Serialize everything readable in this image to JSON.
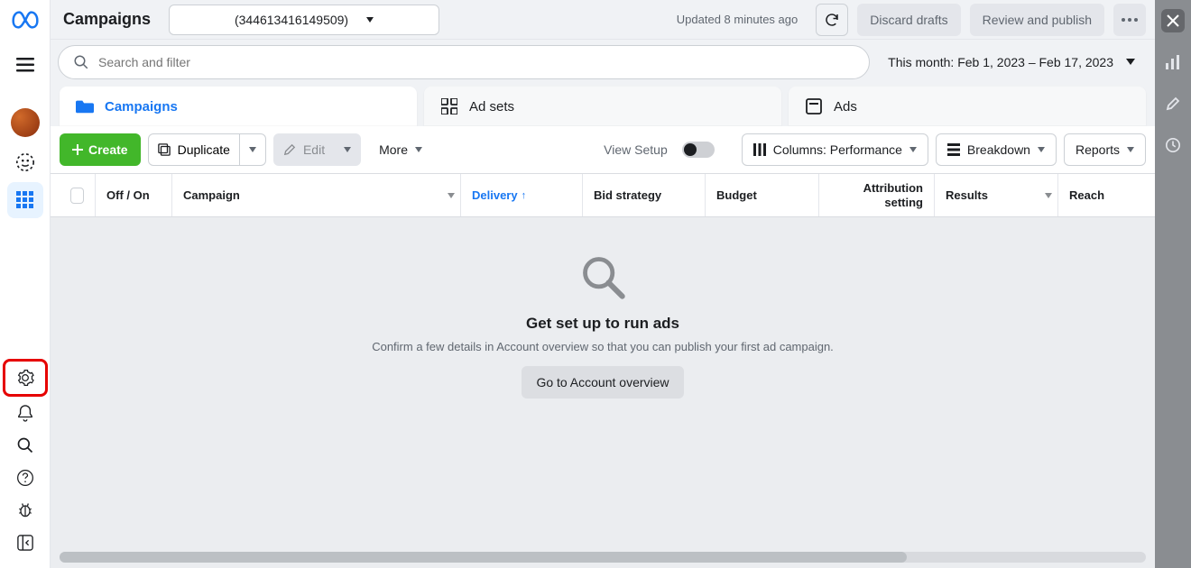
{
  "header": {
    "title": "Campaigns",
    "account_id": "(344613416149509)",
    "updated_text": "Updated 8 minutes ago",
    "discard_label": "Discard drafts",
    "publish_label": "Review and publish"
  },
  "search": {
    "placeholder": "Search and filter",
    "date_range": "This month: Feb 1, 2023 – Feb 17, 2023"
  },
  "tabs": {
    "campaigns": "Campaigns",
    "adsets": "Ad sets",
    "ads": "Ads"
  },
  "toolbar": {
    "create": "Create",
    "duplicate": "Duplicate",
    "edit": "Edit",
    "more": "More",
    "view_setup": "View Setup",
    "columns": "Columns: Performance",
    "breakdown": "Breakdown",
    "reports": "Reports"
  },
  "table": {
    "onoff": "Off / On",
    "campaign": "Campaign",
    "delivery": "Delivery",
    "bid": "Bid strategy",
    "budget": "Budget",
    "attribution": "Attribution setting",
    "results": "Results",
    "reach": "Reach"
  },
  "empty": {
    "title": "Get set up to run ads",
    "subtitle": "Confirm a few details in Account overview so that you can publish your first ad campaign.",
    "cta": "Go to Account overview"
  }
}
